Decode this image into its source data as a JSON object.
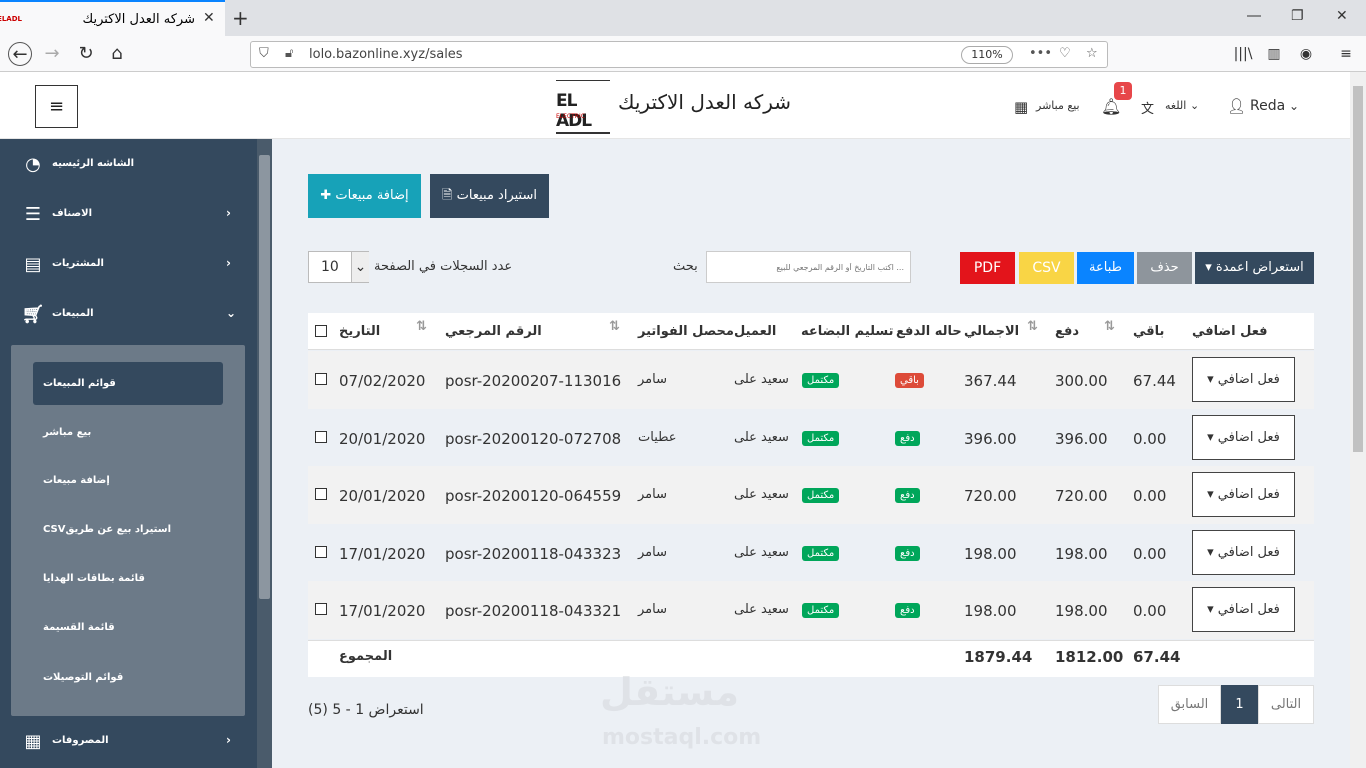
{
  "browser": {
    "tab_title": "شركه العدل الاكتريك",
    "favicon_text": "ELADL",
    "url": "lolo.bazonline.xyz/sales",
    "zoom": "110%"
  },
  "header": {
    "logo_text": "EL ADL",
    "logo_sub": "ELECTRIC",
    "company_name": "شركه العدل الاكتريك",
    "direct_sale": "بيع مباشر",
    "notification_count": "1",
    "language": "اللغه",
    "user": "Reda"
  },
  "sidebar": {
    "items": [
      {
        "label": "الشاشه الرئيسيه"
      },
      {
        "label": "الاصناف"
      },
      {
        "label": "المشتريات"
      },
      {
        "label": "المبيعات"
      },
      {
        "label": "المصروفات"
      }
    ],
    "sales_submenu": [
      {
        "label": "قوائم المبيعات"
      },
      {
        "label": "بيع مباشر"
      },
      {
        "label": "إضافة مبيعات"
      },
      {
        "label": "CSVاستيراد بيع عن طريق"
      },
      {
        "label": "قائمة بطاقات الهدايا"
      },
      {
        "label": "قائمة القسيمة"
      },
      {
        "label": "قوائم التوصيلات"
      }
    ]
  },
  "toolbar": {
    "add_sales": "إضافة مبيعات",
    "import_sales": "استيراد مبيعات",
    "per_page_label": "عدد السجلات في الصفحة",
    "per_page_value": "10",
    "search_label": "بحث",
    "search_placeholder": "... اكتب التاريخ أو الرقم المرجعي للبيع",
    "pdf": "PDF",
    "csv": "CSV",
    "print": "طباعة",
    "delete": "حذف",
    "columns": "استعراض اعمدة",
    "colors": {
      "teal": "#17a2b8",
      "dark": "#34495e",
      "pdf": "#e3141b",
      "csv": "#f9d545",
      "print": "#0a84ff",
      "delete": "#8e959c"
    }
  },
  "table": {
    "headers": {
      "date": "التاريخ",
      "ref": "الرقم المرجعي",
      "collector": "محصل الفواتير",
      "customer": "العميل",
      "delivery": "تسليم البضاعه",
      "payment": "حاله الدفع",
      "total": "الاجمالي",
      "paid": "دفع",
      "due": "باقي",
      "action": "فعل اضافي"
    },
    "rows": [
      {
        "date": "07/02/2020",
        "ref": "posr-20200207-113016",
        "collector": "سامر",
        "customer": "سعيد على",
        "delivery": "مكتمل",
        "payment": "باقي",
        "payment_status": "due",
        "total": "367.44",
        "paid": "300.00",
        "due": "67.44",
        "action": "فعل اضافي"
      },
      {
        "date": "20/01/2020",
        "ref": "posr-20200120-072708",
        "collector": "عطيات",
        "customer": "سعيد على",
        "delivery": "مكتمل",
        "payment": "دفع",
        "payment_status": "paid",
        "total": "396.00",
        "paid": "396.00",
        "due": "0.00",
        "action": "فعل اضافي"
      },
      {
        "date": "20/01/2020",
        "ref": "posr-20200120-064559",
        "collector": "سامر",
        "customer": "سعيد على",
        "delivery": "مكتمل",
        "payment": "دفع",
        "payment_status": "paid",
        "total": "720.00",
        "paid": "720.00",
        "due": "0.00",
        "action": "فعل اضافي"
      },
      {
        "date": "17/01/2020",
        "ref": "posr-20200118-043323",
        "collector": "سامر",
        "customer": "سعيد على",
        "delivery": "مكتمل",
        "payment": "دفع",
        "payment_status": "paid",
        "total": "198.00",
        "paid": "198.00",
        "due": "0.00",
        "action": "فعل اضافي"
      },
      {
        "date": "17/01/2020",
        "ref": "posr-20200118-043321",
        "collector": "سامر",
        "customer": "سعيد على",
        "delivery": "مكتمل",
        "payment": "دفع",
        "payment_status": "paid",
        "total": "198.00",
        "paid": "198.00",
        "due": "0.00",
        "action": "فعل اضافي"
      }
    ],
    "footer": {
      "label": "المجموع",
      "total": "1879.44",
      "paid": "1812.00",
      "due": "67.44"
    }
  },
  "pagination": {
    "info": "استعراض 1 - 5 (5)",
    "next": "التالى",
    "current": "1",
    "prev": "السابق"
  },
  "watermark": {
    "ar": "مستقل",
    "en": "mostaql.com"
  }
}
